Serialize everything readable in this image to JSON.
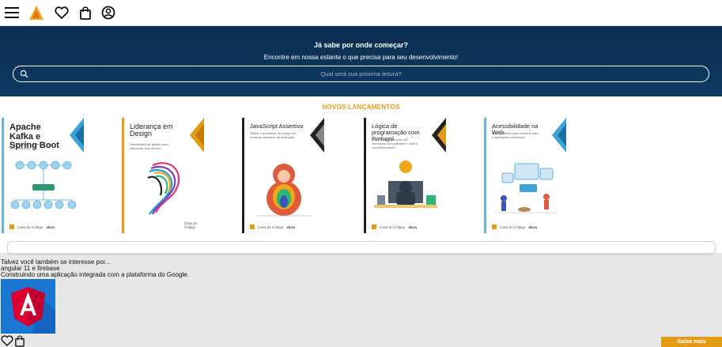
{
  "header": {
    "icons": [
      "menu-icon",
      "logo-icon",
      "heart-icon",
      "shopping-bag-icon",
      "user-icon"
    ]
  },
  "hero": {
    "title": "Já sabe por onde começar?",
    "subtitle": "Encontre em nossa estante o que precisa para seu desenvolvimento!",
    "search_placeholder": "Qual será sua próxima leitura?"
  },
  "releases": {
    "title": "NOVOS LANÇAMENTOS",
    "books": [
      {
        "title": "Apache Kafka e Spring Boot",
        "subtitle": "Comunicação assíncrona entre microsserviços",
        "accent": "#3aa3d8",
        "brand": "alura",
        "publisher": "Casa do Código"
      },
      {
        "title": "Liderança em Design",
        "subtitle": "Habilidades de gestão para alavancar sua carreira",
        "accent": "#e39b16",
        "brand": "",
        "publisher": "Casa do Código"
      },
      {
        "title": "JavaScript Assertivo",
        "subtitle": "Testes e qualidade de código em todas as camadas da aplicação",
        "accent": "#222222",
        "brand": "alura",
        "publisher": "Casa do Código"
      },
      {
        "title": "Lógica de programação com Portugol",
        "subtitle": "Mais de 80 exercícios, 50 exercícios com gabarito e vídeos complementares",
        "accent": "#e39b16",
        "brand": "alura",
        "publisher": "Casa do Código"
      },
      {
        "title": "Acessibilidade na Web",
        "subtitle": "Boas práticas para construir sites e aplicações acessíveis",
        "accent": "#3aa3d8",
        "brand": "alura",
        "publisher": "Casa do Código"
      }
    ]
  },
  "suggestion": {
    "heading": "Talvez você também se interesse por...",
    "title": "angular 11 e firebase",
    "description": "Construindo uma aplicação integrada com a plataforma do Google.",
    "cta_label": "Saiba mais"
  },
  "colors": {
    "accent": "#e39b16",
    "hero_bg": "#0e3a63"
  }
}
